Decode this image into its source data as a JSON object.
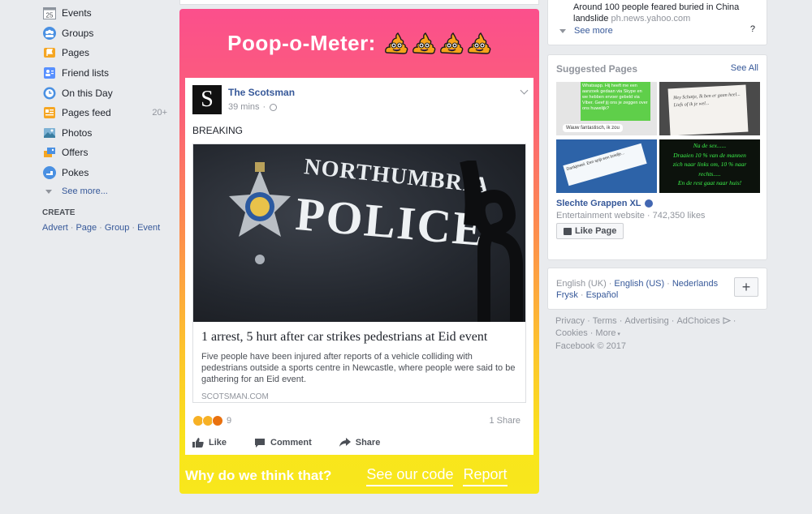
{
  "left_nav": {
    "items": [
      {
        "label": "Events",
        "icon": "calendar-icon",
        "badge": "25"
      },
      {
        "label": "Groups",
        "icon": "groups-icon"
      },
      {
        "label": "Pages",
        "icon": "flag-icon"
      },
      {
        "label": "Friend lists",
        "icon": "friend-list-icon"
      },
      {
        "label": "On this Day",
        "icon": "clock-icon"
      },
      {
        "label": "Pages feed",
        "icon": "pages-feed-icon",
        "count": "20+"
      },
      {
        "label": "Photos",
        "icon": "photos-icon"
      },
      {
        "label": "Offers",
        "icon": "offers-icon"
      },
      {
        "label": "Pokes",
        "icon": "poke-icon"
      }
    ],
    "see_more": "See more...",
    "create_title": "CREATE",
    "create_links": [
      "Advert",
      "Page",
      "Group",
      "Event"
    ]
  },
  "meter": {
    "title": "Poop-o-Meter:",
    "footer_question": "Why do we think that?",
    "see_code": "See our code",
    "report": "Report",
    "colors": {
      "top": "#fb4f8c",
      "bottom": "#f8e71c"
    }
  },
  "post": {
    "source_name": "The Scotsman",
    "source_logo_letter": "S",
    "time": "39 mins",
    "text": "BREAKING",
    "link": {
      "image_text_1": "NORTHUMBRIA",
      "image_text_2": "POLICE",
      "title": "1 arrest, 5 hurt after car strikes pedestrians at Eid event",
      "description": "Five people have been injured after reports of a vehicle colliding with pedestrians outside a sports centre in Newcastle, where people were said to be gathering for an Eid event.",
      "domain": "SCOTSMAN.COM"
    },
    "reaction_count": "9",
    "shares": "1 Share",
    "actions": {
      "like": "Like",
      "comment": "Comment",
      "share": "Share"
    }
  },
  "right": {
    "news": {
      "headline": "Around 100 people feared buried in China landslide",
      "source": "ph.news.yahoo.com",
      "see_more": "See more",
      "help": "?"
    },
    "suggested": {
      "title": "Suggested Pages",
      "see_all": "See All",
      "thumb1_text": "Whatsapp. Hij heeft me een aanzoek gedaan via Skype en we hebben ervoer gebeld via Viber. Geef jij ons je zeggen over ons huwelijk?",
      "thumb1_reply": "Wauw fantastisch, ik zou",
      "thumb2_text": "Hey Schatje, Ik ben er gaan heel... Liefs of ik je wel...",
      "thumb3_text": "Dankjewel. Een spijt een briefje...",
      "thumb4_lines": [
        "Na de sex......",
        "Draaien 10 % van de mannen",
        "zich naar links om, 10 % naar",
        "rechts.....",
        "En de rest gaat naar huis!"
      ],
      "page_name": "Slechte Grappen XL",
      "page_sub": "Entertainment website · 742,350 likes",
      "like_button": "Like Page"
    },
    "languages": {
      "current": "English (UK)",
      "line1_links": [
        "English (US)",
        "Nederlands"
      ],
      "line2_links": [
        "Frysk",
        "Español"
      ],
      "add": "+"
    },
    "footer": {
      "line1": [
        "Privacy",
        "Terms",
        "Advertising",
        "AdChoices"
      ],
      "line2": [
        "Cookies",
        "More"
      ],
      "copyright": "Facebook © 2017"
    }
  }
}
